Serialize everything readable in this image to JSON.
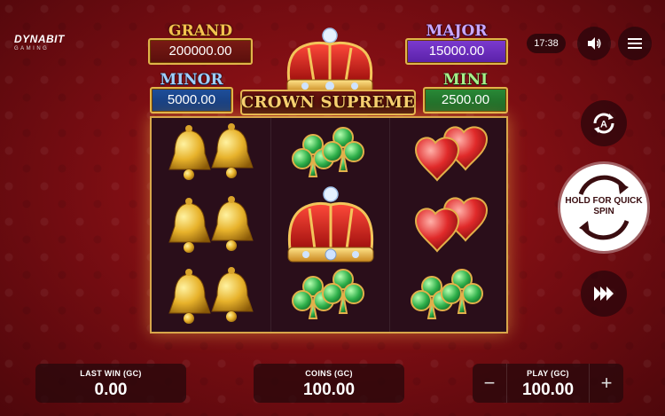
{
  "brand": {
    "line1": "DYNABIT",
    "line2": "GAMING"
  },
  "jackpots": {
    "grand": {
      "label": "GRAND",
      "value": "200000.00"
    },
    "major": {
      "label": "MAJOR",
      "value": "15000.00"
    },
    "minor": {
      "label": "MINOR",
      "value": "5000.00"
    },
    "mini": {
      "label": "MINI",
      "value": "2500.00"
    }
  },
  "game_title": "CROWN SUPREME",
  "clock": "17:38",
  "reels": [
    [
      "bell",
      "bell",
      "bell"
    ],
    [
      "clover",
      "crown",
      "clover"
    ],
    [
      "heart",
      "heart",
      "clover"
    ]
  ],
  "controls": {
    "sound_icon": "speaker-icon",
    "menu_icon": "hamburger-menu-icon",
    "autoplay_icon": "autoplay-icon",
    "spin_label": "HOLD FOR QUICK SPIN",
    "turbo_icon": "fast-forward-icon"
  },
  "panels": {
    "last_win": {
      "label": "LAST WIN (GC)",
      "value": "0.00"
    },
    "coins": {
      "label": "COINS (GC)",
      "value": "100.00"
    },
    "play": {
      "label": "PLAY (GC)",
      "value": "100.00",
      "minus": "−",
      "plus": "+"
    }
  },
  "colors": {
    "accent_gold": "#e0b44a",
    "background_red": "#7e0e13"
  }
}
